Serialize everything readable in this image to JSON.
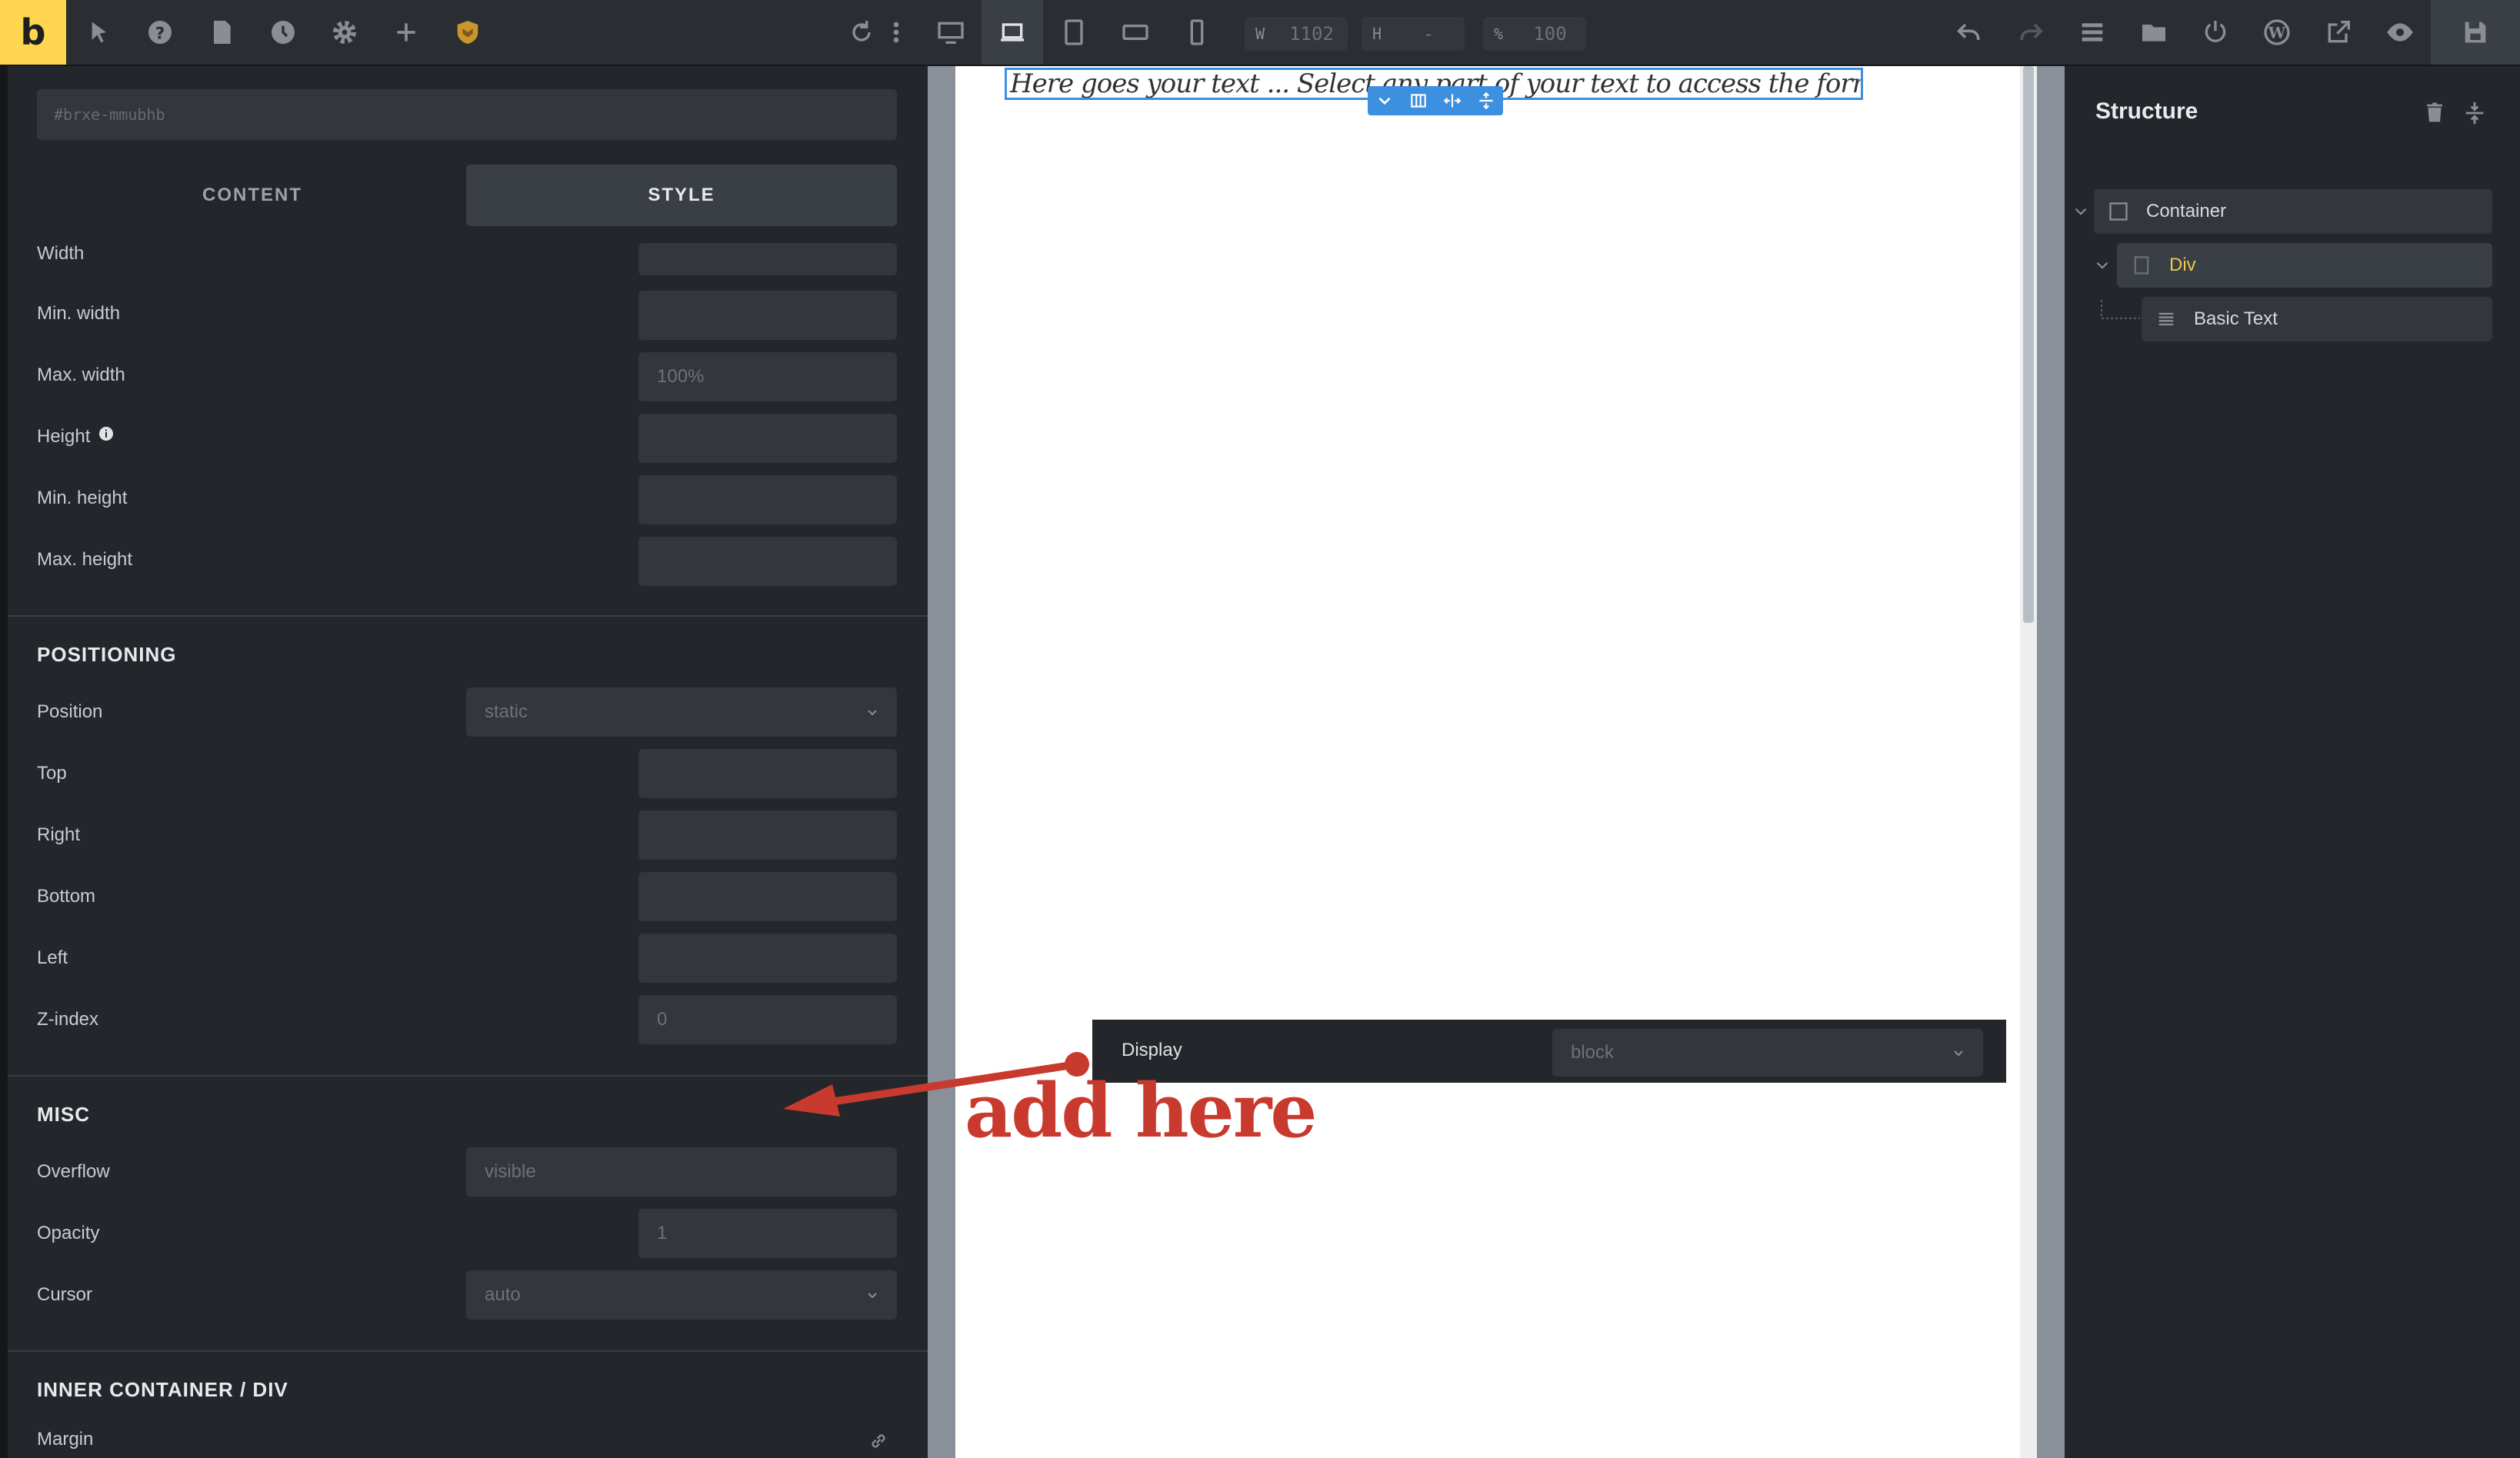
{
  "toolbar": {
    "logo": "b",
    "dims": {
      "width_label": "W",
      "width_value": "1102",
      "height_label": "H",
      "height_value": "-",
      "scale_label": "%",
      "scale_value": "100"
    }
  },
  "element": {
    "id": "#brxe-mmubhb"
  },
  "tabs": {
    "content": "CONTENT",
    "style": "STYLE"
  },
  "fields": {
    "width": {
      "label": "Width",
      "value": ""
    },
    "min_width": {
      "label": "Min. width",
      "value": ""
    },
    "max_width": {
      "label": "Max. width",
      "value": "100%"
    },
    "height": {
      "label": "Height",
      "value": ""
    },
    "min_height": {
      "label": "Min. height",
      "value": ""
    },
    "max_height": {
      "label": "Max. height",
      "value": ""
    }
  },
  "positioning": {
    "title": "POSITIONING",
    "position": {
      "label": "Position",
      "value": "static"
    },
    "top": {
      "label": "Top",
      "value": ""
    },
    "right": {
      "label": "Right",
      "value": ""
    },
    "bottom": {
      "label": "Bottom",
      "value": ""
    },
    "left": {
      "label": "Left",
      "value": ""
    },
    "zindex": {
      "label": "Z-index",
      "value": "0"
    }
  },
  "misc": {
    "title": "MISC",
    "overflow": {
      "label": "Overflow",
      "value": "visible"
    },
    "opacity": {
      "label": "Opacity",
      "value": "1"
    },
    "cursor": {
      "label": "Cursor",
      "value": "auto"
    }
  },
  "inner": {
    "title": "INNER CONTAINER / DIV",
    "margin_label": "Margin"
  },
  "canvas": {
    "text": "Here goes your text ... Select any part of your text to access the formatting toolbar.",
    "display_label": "Display",
    "display_value": "block"
  },
  "annotation": {
    "text": "add here",
    "color": "#c8392e"
  },
  "structure": {
    "title": "Structure",
    "nodes": [
      "Container",
      "Div",
      "Basic Text"
    ],
    "active_color": "#f0c94a"
  }
}
